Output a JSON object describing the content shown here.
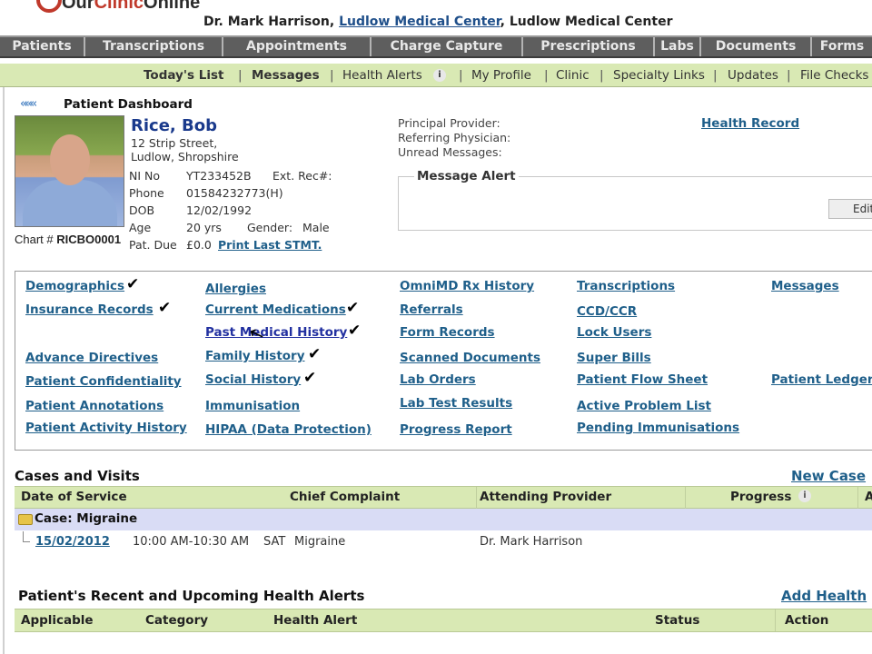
{
  "header": {
    "logo_text_a": "Our",
    "logo_text_b": "Clinic",
    "logo_text_c": "Online",
    "provider": "Dr. Mark Harrison,",
    "clinic_link": "Ludlow Medical Center",
    "clinic_plain": ", Ludlow Medical Center"
  },
  "main_nav": [
    "Patients",
    "Transcriptions",
    "Appointments",
    "Charge Capture",
    "Prescriptions",
    "Labs",
    "Documents",
    "Forms"
  ],
  "sub_nav": {
    "todays_list": "Today's List",
    "messages": "Messages",
    "health_alerts": "Health Alerts",
    "my_profile": "My Profile",
    "clinic": "Clinic",
    "specialty_links": "Specialty Links",
    "updates": "Updates",
    "file_checks": "File Checks"
  },
  "dashboard": {
    "arrows": "«««",
    "title": "Patient Dashboard"
  },
  "patient": {
    "name": "Rice, Bob",
    "address1": "12 Strip Street,",
    "address2": "Ludlow, Shropshire",
    "ni_label": "NI No",
    "ni_value": "YT233452B",
    "ext_label": "Ext. Rec#:",
    "phone_label": "Phone",
    "phone_value": "01584232773(H)",
    "dob_label": "DOB",
    "dob_value": "12/02/1992",
    "age_label": "Age",
    "age_value": "20 yrs",
    "gender_label": "Gender:",
    "gender_value": "Male",
    "due_label": "Pat. Due",
    "due_value": "£0.0",
    "print_link": "Print Last STMT.",
    "chart_label": "Chart #",
    "chart_value": "RICBO0001"
  },
  "providers": {
    "principal": "Principal Provider:",
    "referring": "Referring Physician:",
    "unread": "Unread Messages:",
    "health_record": "Health Record"
  },
  "message_alert": {
    "title": "Message Alert",
    "edit": "Edit"
  },
  "links": {
    "col1": [
      "Demographics",
      "Insurance Records",
      "Advance Directives",
      "Patient Confidentiality",
      "Patient Annotations",
      "Patient Activity History"
    ],
    "col2": [
      "Allergies",
      "Current Medications",
      "Past Medical History",
      "Family History",
      "Social History",
      "Immunisation",
      "HIPAA (Data Protection)"
    ],
    "col3": [
      "OmniMD Rx History",
      "Referrals",
      "Form Records",
      "Scanned Documents",
      "Lab Orders",
      "Lab Test Results",
      "Progress Report"
    ],
    "col4": [
      "Transcriptions",
      "CCD/CCR",
      "Lock Users",
      "Super Bills",
      "Patient Flow Sheet",
      "Active Problem List",
      "Pending Immunisations"
    ],
    "col5": [
      "Messages",
      "Patient Ledger"
    ],
    "check": "✔"
  },
  "cases": {
    "title": "Cases and Visits",
    "new_case": "New Case",
    "headers": [
      "Date of Service",
      "Chief Complaint",
      "Attending Provider",
      "Progress",
      "A"
    ],
    "case_label": "Case: Migraine",
    "visit": {
      "date": "15/02/2012",
      "time": "10:00 AM-10:30 AM",
      "day": "SAT",
      "complaint": "Migraine",
      "provider": "Dr. Mark Harrison"
    }
  },
  "health_alerts": {
    "title": "Patient's Recent and Upcoming Health Alerts",
    "add": "Add Health",
    "headers": [
      "Applicable",
      "Category",
      "Health Alert",
      "Status",
      "Action"
    ]
  }
}
